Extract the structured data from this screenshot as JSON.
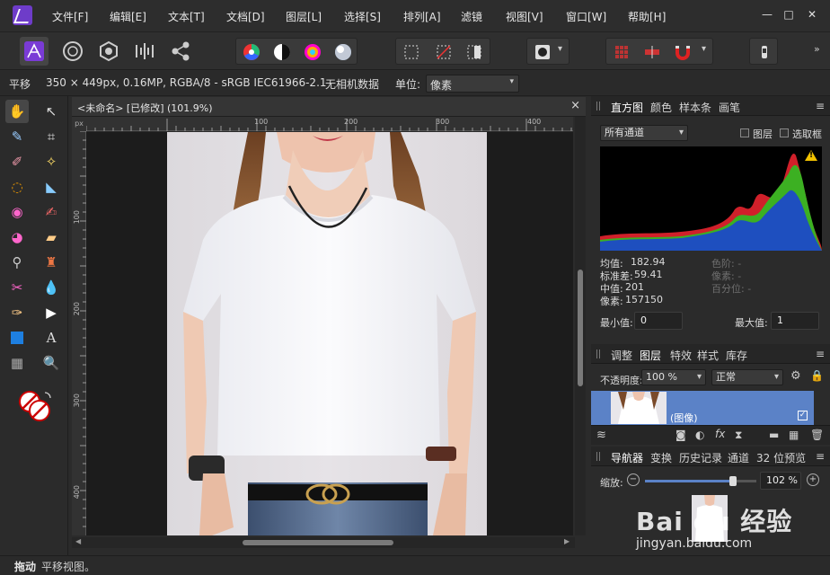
{
  "menu": [
    "文件[F]",
    "编辑[E]",
    "文本[T]",
    "文档[D]",
    "图层[L]",
    "选择[S]",
    "排列[A]",
    "滤镜",
    "视图[V]",
    "窗口[W]",
    "帮助[H]"
  ],
  "window_controls": {
    "minimize": "—",
    "maximize": "□",
    "close": "✕"
  },
  "context": {
    "tool_name": "平移",
    "doc_info": "350 × 449px, 0.16MP, RGBA/8 - sRGB IEC61966-2.1",
    "metadata": "无相机数据",
    "unit_label": "单位:",
    "unit_value": "像素"
  },
  "document": {
    "tab_title": "<未命名> [已修改] (101.9%)",
    "close": "×",
    "ruler_unit": "px",
    "ruler_top": [
      "100",
      "200",
      "300",
      "400"
    ],
    "ruler_left": [
      "100",
      "200",
      "300",
      "400"
    ]
  },
  "histogram_panel": {
    "tabs": [
      "直方图",
      "颜色",
      "样本条",
      "画笔"
    ],
    "channel": "所有通道",
    "chk_layer": "图层",
    "chk_selection": "选取框",
    "warning": "!",
    "stats_left": [
      {
        "label": "均值:",
        "value": "182.94"
      },
      {
        "label": "标准差:",
        "value": "59.41"
      },
      {
        "label": "中值:",
        "value": "201"
      },
      {
        "label": "像素:",
        "value": "157150"
      }
    ],
    "stats_right": [
      "色阶: -",
      "像素: -",
      "百分位: -"
    ],
    "min_label": "最小值:",
    "min_value": "0",
    "max_label": "最大值:",
    "max_value": "1"
  },
  "layers_panel": {
    "tabs": [
      "调整",
      "图层",
      "特效",
      "样式",
      "库存"
    ],
    "opacity_label": "不透明度:",
    "opacity_value": "100 %",
    "blend_mode": "正常",
    "layer_name": "(图像)",
    "fx": "fx"
  },
  "navigator_panel": {
    "tabs": [
      "导航器",
      "变换",
      "历史记录",
      "通道",
      "32 位预览"
    ],
    "zoom_label": "缩放:",
    "zoom_value": "102 %",
    "zoom_fraction": 0.79
  },
  "watermark": {
    "brand": "Bai du 经验",
    "url": "jingyan.baidu.com"
  },
  "status": {
    "bold": "拖动",
    "text": "平移视图。"
  },
  "colors": {
    "accent": "#5b82c7",
    "red": "#d0202a",
    "green": "#3cb022",
    "blue": "#1e4fbf"
  }
}
